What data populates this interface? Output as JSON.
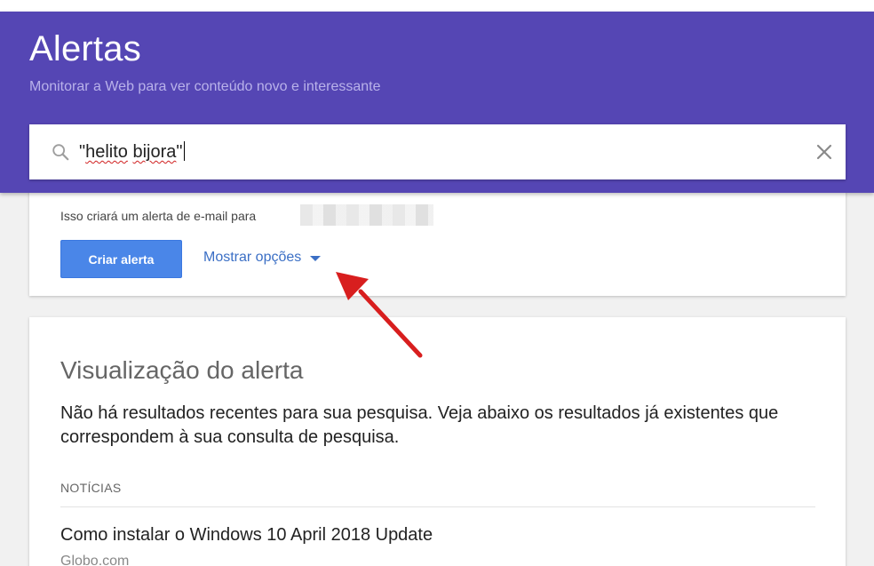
{
  "header": {
    "title": "Alertas",
    "subtitle": "Monitorar a Web para ver conteúdo novo e interessante"
  },
  "search": {
    "query_prefix": "\"",
    "query_word1": "helito",
    "query_space": " ",
    "query_word2": "bijora",
    "query_suffix": "\"",
    "icon": "search-icon",
    "clear_icon": "close-icon"
  },
  "create_card": {
    "email_note": "Isso criará um alerta de e-mail para",
    "create_button": "Criar alerta",
    "show_options": "Mostrar opções",
    "button_color": "#4a86e8",
    "link_color": "#3b6fc5"
  },
  "preview": {
    "title": "Visualização do alerta",
    "message": "Não há resultados recentes para sua pesquisa. Veja abaixo os resultados já existentes que correspondem à sua consulta de pesquisa.",
    "section_heading": "NOTÍCIAS",
    "results": [
      {
        "title": "Como instalar o Windows 10 April 2018 Update",
        "source": "Globo.com"
      }
    ]
  },
  "annotation": {
    "arrow_color": "#d81e1e"
  },
  "colors": {
    "header_bg": "#5546b4",
    "page_bg": "#f1f1f1"
  }
}
